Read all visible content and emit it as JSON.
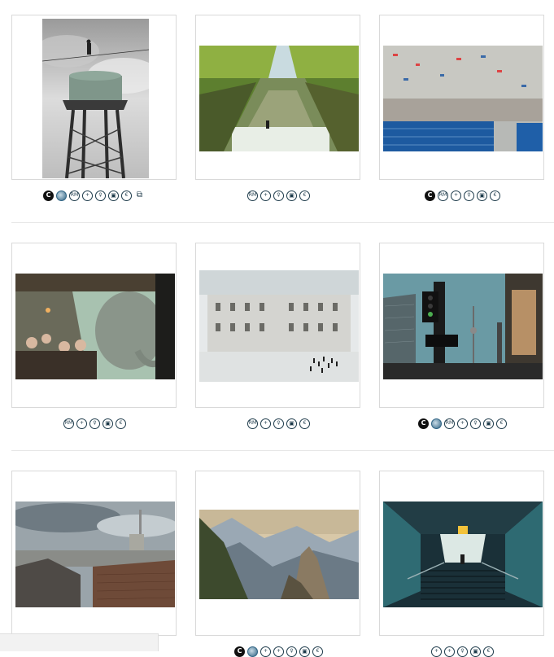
{
  "icon_badges": {
    "copyright": "C",
    "rights_managed": "RM",
    "add": "+",
    "lightbox": "♀",
    "cart": "▣",
    "euro": "€",
    "stack": "⧉"
  },
  "colors": {
    "icon_stroke": "#1d3a4a",
    "card_border": "#d9d9d9",
    "divider": "#e6e6e6"
  },
  "gallery": [
    {
      "title": "",
      "icons": [
        "copyright-filled",
        "blue-dot",
        "rights-managed",
        "add",
        "lightbox",
        "cart",
        "euro",
        "stack"
      ]
    },
    {
      "title": "",
      "icons": [
        "rights-managed",
        "add",
        "lightbox",
        "cart",
        "euro"
      ]
    },
    {
      "title": "",
      "icons": [
        "copyright-filled",
        "rights-managed",
        "add",
        "lightbox",
        "cart",
        "euro"
      ]
    },
    {
      "title": "",
      "icons": [
        "rights-managed",
        "add",
        "lightbox",
        "cart",
        "euro"
      ]
    },
    {
      "title": "",
      "icons": [
        "rights-managed",
        "add",
        "lightbox",
        "cart",
        "euro"
      ]
    },
    {
      "title": "",
      "icons": [
        "copyright-filled",
        "blue-dot",
        "rights-managed",
        "add",
        "lightbox",
        "cart",
        "euro"
      ]
    },
    {
      "title": "",
      "icons": []
    },
    {
      "title": "",
      "icons": [
        "copyright-filled",
        "blue-dot",
        "add",
        "add",
        "lightbox",
        "cart",
        "euro"
      ]
    },
    {
      "title": "",
      "icons": [
        "add",
        "add",
        "lightbox",
        "cart",
        "euro"
      ]
    }
  ]
}
